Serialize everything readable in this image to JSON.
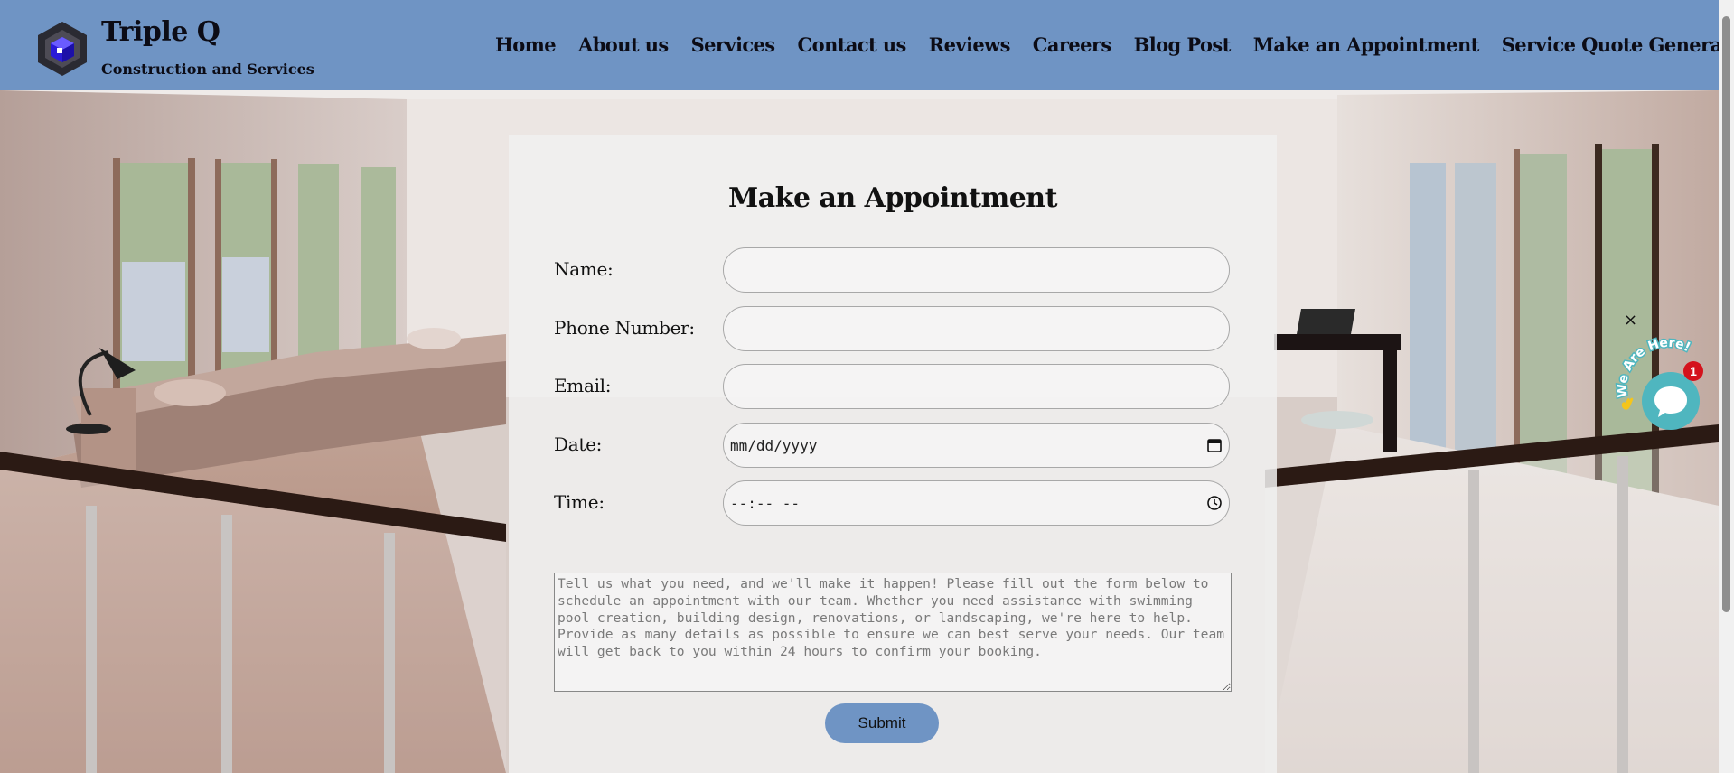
{
  "header": {
    "brand_name": "Triple Q",
    "brand_tagline": "Construction and Services",
    "background_color": "#6f94c4",
    "logo_icon": "cube-logo-icon"
  },
  "nav": {
    "items": [
      {
        "label": "Home"
      },
      {
        "label": "About us"
      },
      {
        "label": "Services"
      },
      {
        "label": "Contact us"
      },
      {
        "label": "Reviews"
      },
      {
        "label": "Careers"
      },
      {
        "label": "Blog Post"
      },
      {
        "label": "Make an Appointment"
      },
      {
        "label": "Service Quote Generator"
      }
    ]
  },
  "form": {
    "title": "Make an Appointment",
    "name_label": "Name:",
    "name_value": "",
    "phone_label": "Phone Number:",
    "phone_value": "",
    "email_label": "Email:",
    "email_value": "",
    "date_label": "Date:",
    "date_placeholder": "mm/dd/yyyy",
    "date_icon": "calendar-icon",
    "time_label": "Time:",
    "time_placeholder": "--:-- --",
    "time_icon": "clock-icon",
    "message_placeholder": "Tell us what you need, and we'll make it happen! Please fill out the form below to schedule an appointment with our team. Whether you need assistance with swimming pool creation, building design, renovations, or landscaping, we're here to help. Provide as many details as possible to ensure we can best serve your needs. Our team will get back to you within 24 hours to confirm your booking.",
    "submit_label": "Submit",
    "accent_color": "#6f94c4"
  },
  "chat": {
    "close_glyph": "×",
    "arc_text": "We Are Here!",
    "badge_count": "1",
    "bubble_color": "#4fb6bf",
    "badge_color": "#d4121c",
    "icon": "chat-bubble-icon",
    "wave_icon": "waving-hand-icon"
  }
}
